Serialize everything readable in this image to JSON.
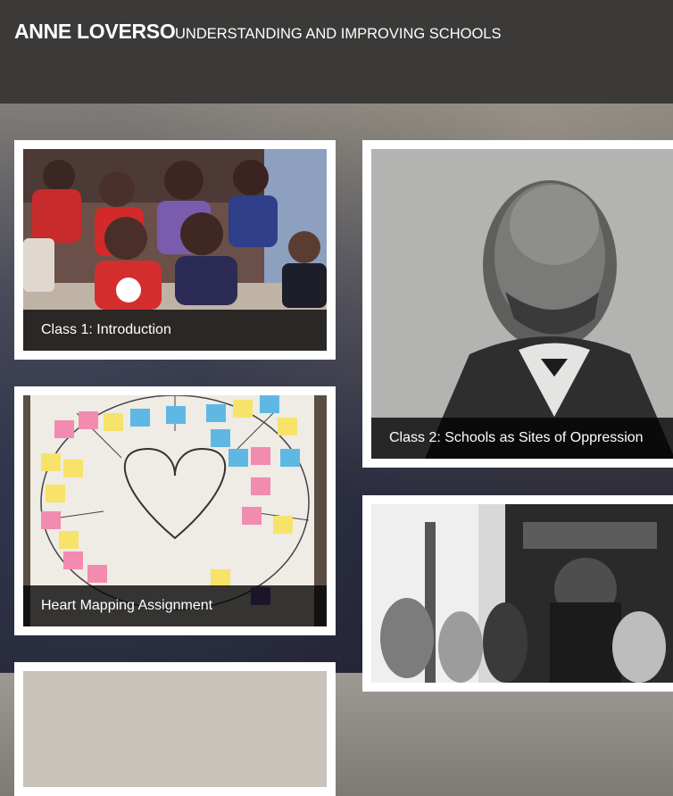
{
  "header": {
    "site_title": "ANNE LOVERSO",
    "tagline": "UNDERSTANDING AND IMPROVING SCHOOLS"
  },
  "cards": [
    {
      "caption": "Class 1: Introduction",
      "image": "classroom-children-photo"
    },
    {
      "caption": "Class 2: Schools as Sites of Oppression",
      "image": "historic-portrait-photo"
    },
    {
      "caption": "Heart Mapping Assignment",
      "image": "heart-map-poster-photo"
    },
    {
      "caption": "",
      "image": "historic-classroom-photo"
    },
    {
      "caption": "",
      "image": "partially-visible-photo"
    }
  ]
}
